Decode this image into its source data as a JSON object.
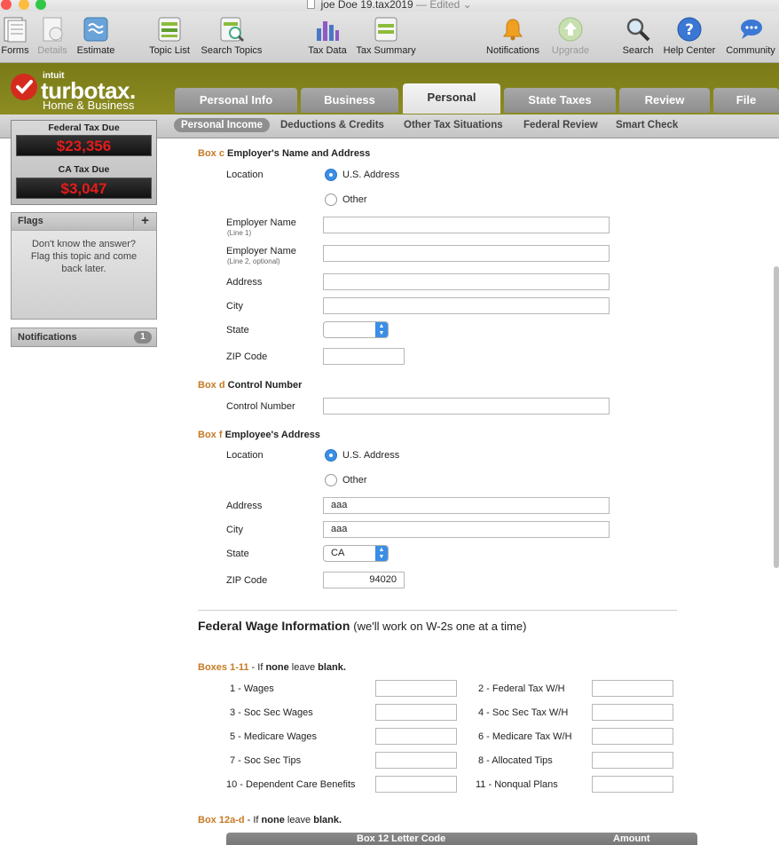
{
  "window": {
    "title": "joe Doe 19.tax2019",
    "edited": "— Edited"
  },
  "toolbar": [
    {
      "label": "Forms",
      "icon": "forms-icon"
    },
    {
      "label": "Details",
      "icon": "details-icon",
      "disabled": true
    },
    {
      "label": "Estimate",
      "icon": "estimate-icon"
    },
    {
      "label": "Topic List",
      "icon": "topic-list-icon"
    },
    {
      "label": "Search Topics",
      "icon": "search-topics-icon"
    },
    {
      "label": "Tax Data",
      "icon": "tax-data-icon"
    },
    {
      "label": "Tax Summary",
      "icon": "tax-summary-icon"
    },
    {
      "label": "Notifications",
      "icon": "bell-icon"
    },
    {
      "label": "Upgrade",
      "icon": "upgrade-icon",
      "disabled": true
    },
    {
      "label": "Search",
      "icon": "magnifier-icon"
    },
    {
      "label": "Help Center",
      "icon": "help-icon"
    },
    {
      "label": "Community",
      "icon": "community-icon"
    }
  ],
  "logo": {
    "intuit": "intuit",
    "name": "turbotax.",
    "edition": "Home & Business"
  },
  "tabs": [
    "Personal Info",
    "Business",
    "Personal",
    "State Taxes",
    "Review",
    "File"
  ],
  "active_tab": "Personal",
  "subtabs": [
    "Personal Income",
    "Deductions & Credits",
    "Other Tax Situations",
    "Federal Review",
    "Smart Check"
  ],
  "sidebar": {
    "federal_label": "Federal Tax Due",
    "federal_value": "$23,356",
    "state_label": "CA Tax Due",
    "state_value": "$3,047",
    "flags_title": "Flags",
    "flags_add": "+",
    "flags_text": "Don't know the answer? Flag this topic and come back later.",
    "notifications_label": "Notifications",
    "notifications_count": "1"
  },
  "box_c": {
    "prefix": "Box c",
    "title": "Employer's Name and Address",
    "location_label": "Location",
    "opt_us": "U.S. Address",
    "opt_other": "Other",
    "name1_label": "Employer Name",
    "name1_sub": "(Line 1)",
    "name1_value": "",
    "name2_label": "Employer Name",
    "name2_sub": "(Line 2, optional)",
    "name2_value": "",
    "address_label": "Address",
    "address_value": "",
    "city_label": "City",
    "city_value": "",
    "state_label": "State",
    "state_value": "",
    "zip_label": "ZIP Code",
    "zip_value": ""
  },
  "box_d": {
    "prefix": "Box d",
    "title": "Control Number",
    "label": "Control Number",
    "value": ""
  },
  "box_f": {
    "prefix": "Box f",
    "title": "Employee's Address",
    "location_label": "Location",
    "opt_us": "U.S. Address",
    "opt_other": "Other",
    "address_label": "Address",
    "address_value": "aaa",
    "city_label": "City",
    "city_value": "aaa",
    "state_label": "State",
    "state_value": "CA",
    "zip_label": "ZIP Code",
    "zip_value": "94020"
  },
  "wage": {
    "title": "Federal Wage Information",
    "subtitle": "(we'll work on W-2s one at a time)",
    "boxes_prefix": "Boxes 1-11",
    "boxes_mid": " - If ",
    "boxes_none": "none",
    "boxes_end": " leave ",
    "boxes_blank": "blank.",
    "left": [
      {
        "label": "1 - Wages",
        "value": ""
      },
      {
        "label": "3 - Soc Sec Wages",
        "value": ""
      },
      {
        "label": "5 - Medicare Wages",
        "value": ""
      },
      {
        "label": "7 - Soc Sec Tips",
        "value": ""
      },
      {
        "label": "10 - Dependent Care Benefits",
        "value": ""
      }
    ],
    "right": [
      {
        "label": "2 - Federal Tax W/H",
        "value": ""
      },
      {
        "label": "4 - Soc Sec Tax W/H",
        "value": ""
      },
      {
        "label": "6 - Medicare Tax W/H",
        "value": ""
      },
      {
        "label": "8 - Allocated Tips",
        "value": ""
      },
      {
        "label": "11 - Nonqual Plans",
        "value": ""
      }
    ]
  },
  "box12": {
    "prefix": "Box 12a-d",
    "mid": " - If ",
    "none": "none",
    "end": " leave ",
    "blank": "blank.",
    "col_code": "Box 12 Letter Code",
    "col_amount": "Amount"
  }
}
